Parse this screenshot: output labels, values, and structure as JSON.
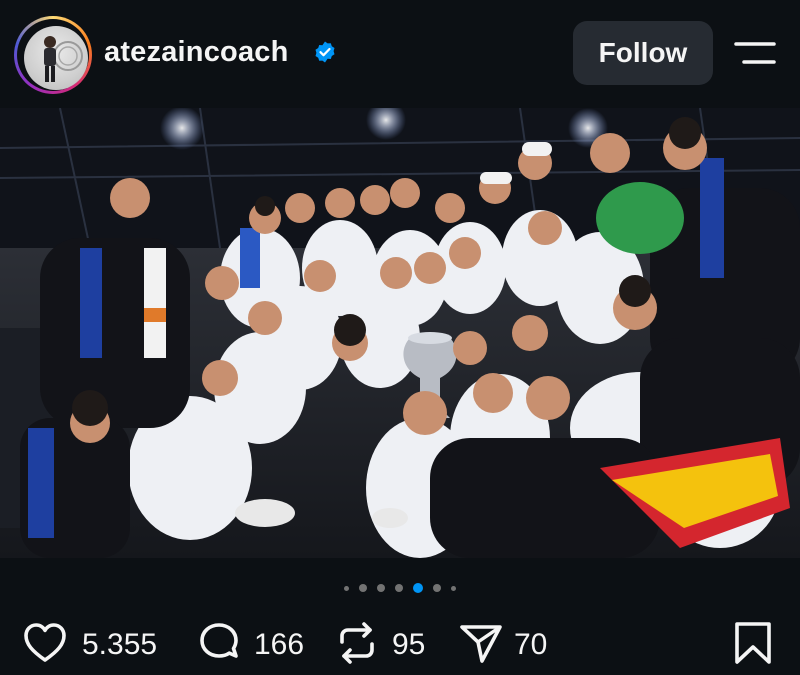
{
  "header": {
    "username": "atezaincoach",
    "verified": true,
    "follow_label": "Follow",
    "avatar": "profile-photo"
  },
  "post": {
    "image": "team-celebration-photo",
    "carousel": {
      "count": 7,
      "active_index": 4
    }
  },
  "actions": {
    "likes": "5.355",
    "comments": "166",
    "reposts": "95",
    "shares": "70"
  },
  "colors": {
    "background": "#0c1014",
    "follow_button": "#262b32",
    "verified": "#0095f6",
    "active_dot": "#0095f6"
  },
  "icons": [
    "menu-icon",
    "verified-icon",
    "heart-icon",
    "comment-icon",
    "repost-icon",
    "share-icon",
    "bookmark-icon"
  ]
}
